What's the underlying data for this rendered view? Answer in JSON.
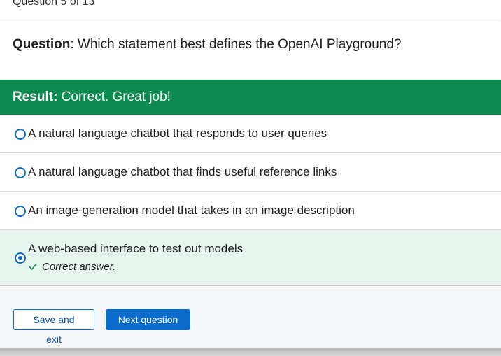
{
  "header": {
    "counter": "Question 5 of 13"
  },
  "question": {
    "label": "Question",
    "text": ": Which statement best defines the OpenAI Playground?"
  },
  "result": {
    "label": "Result:",
    "text": " Correct. Great job!",
    "color": "#0a8a4f"
  },
  "options": [
    {
      "label": "A natural language chatbot that responds to user queries",
      "selected": false
    },
    {
      "label": "A natural language chatbot that finds useful reference links",
      "selected": false
    },
    {
      "label": "An image-generation model that takes in an image description",
      "selected": false
    },
    {
      "label": "A web-based interface to test out models",
      "selected": true,
      "feedback": "Correct answer."
    }
  ],
  "footer": {
    "save_label": "Save and exit",
    "next_label": "Next question"
  },
  "colors": {
    "accent": "#0b6bcb",
    "selected_bg": "#e6f4ee",
    "check": "#0a8a4f"
  }
}
